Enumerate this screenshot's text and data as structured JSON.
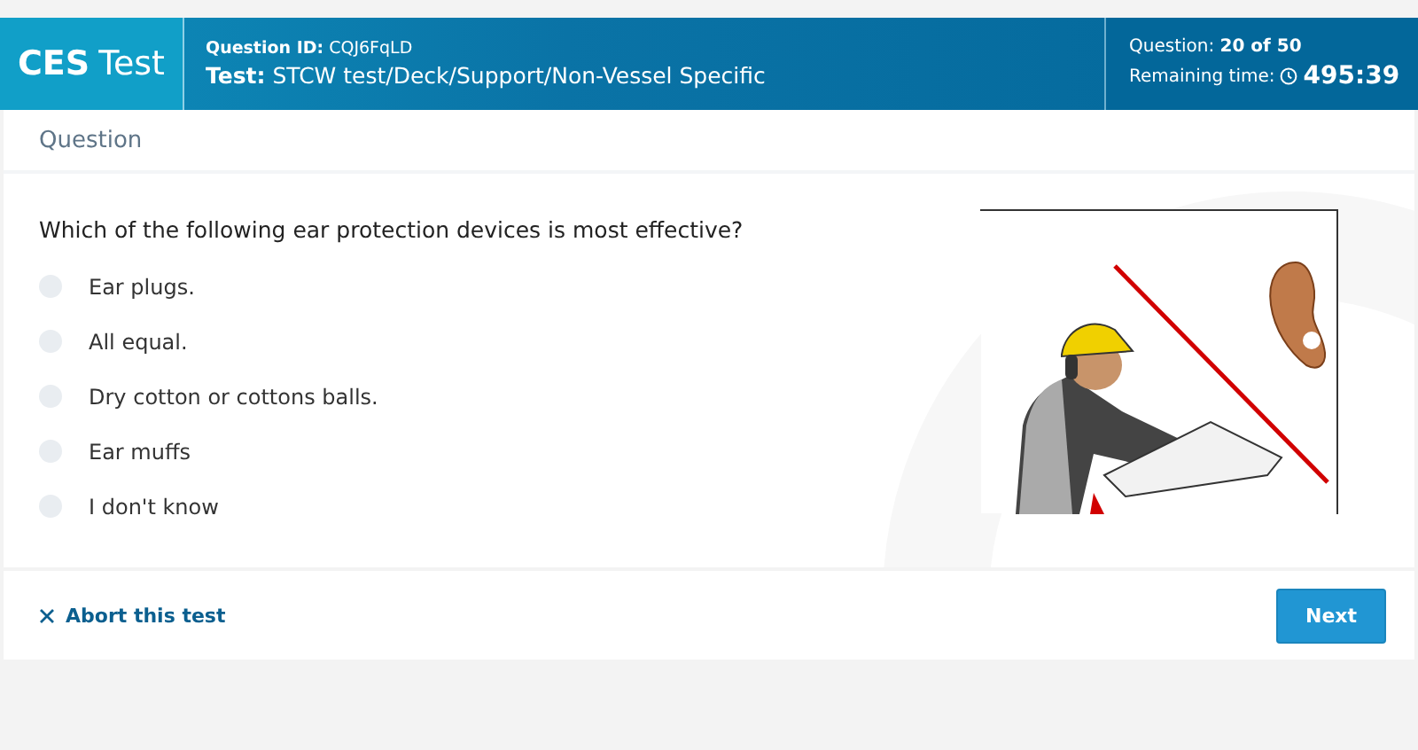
{
  "header": {
    "brand_bold": "CES",
    "brand_rest": "Test",
    "question_id": "**Question ID:** CQJ6FqLD",
    "test": "**Test:** STCW test/Deck/Support/Non-Vessel Specific",
    "progress": "Question: **20 of 50**",
    "remaining_label": "Remaining time:",
    "remaining_time": "495:39"
  },
  "section_tab": "Question",
  "question": "Which of the following ear protection devices is most effective?",
  "options": [
    {
      "label": "Ear plugs.",
      "selected": false
    },
    {
      "label": "All equal.",
      "selected": false
    },
    {
      "label": "Dry cotton or cottons balls.",
      "selected": false
    },
    {
      "label": "Ear muffs",
      "selected": false
    },
    {
      "label": "I don't know",
      "selected": false
    }
  ],
  "footer": {
    "abort": "Abort this test",
    "next": "Next"
  }
}
